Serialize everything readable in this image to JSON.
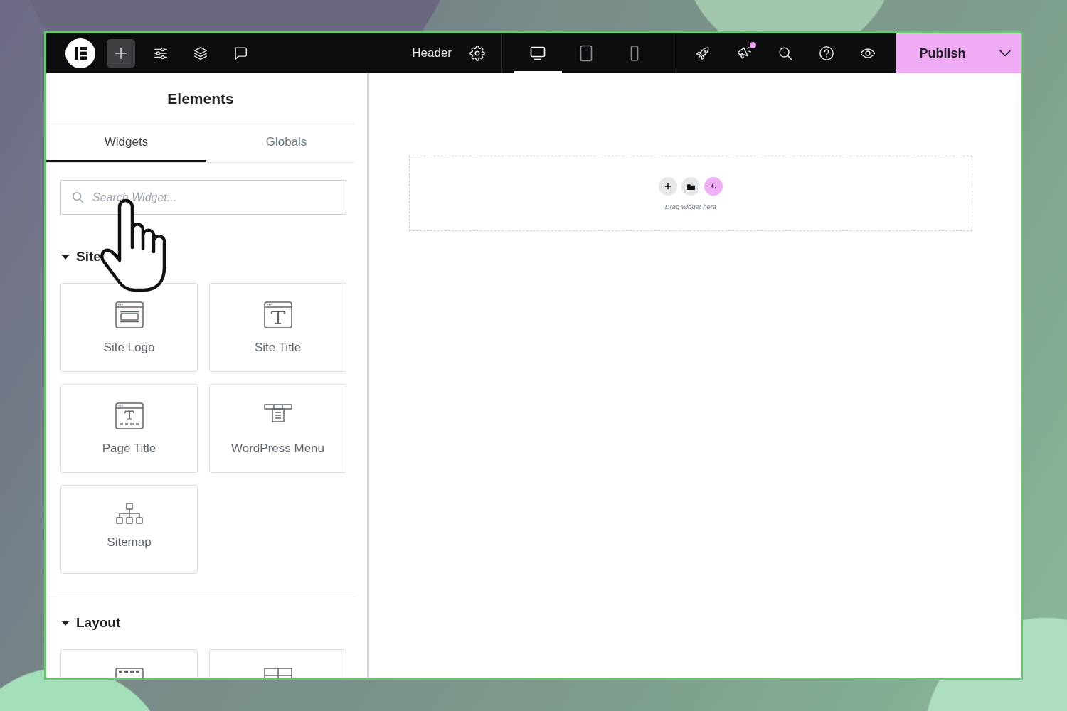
{
  "top_bar": {
    "left_tools": [
      {
        "selected": true
      },
      {
        "selected": false
      },
      {
        "selected": false
      },
      {
        "selected": false
      }
    ],
    "document": {
      "title": "Header"
    },
    "devices": [
      {
        "selected": true
      },
      {
        "selected": false
      },
      {
        "selected": false
      }
    ],
    "right_tools": [
      {
        "badge": false
      },
      {
        "badge": true
      },
      {
        "badge": false
      },
      {
        "badge": false
      },
      {
        "badge": false
      }
    ],
    "publish": {
      "label": "Publish"
    }
  },
  "panel": {
    "title": "Elements",
    "tabs": [
      {
        "label": "Widgets",
        "selected": true
      },
      {
        "label": "Globals",
        "selected": false
      }
    ],
    "search": {
      "placeholder": "Search Widget..."
    },
    "sections": [
      {
        "title": "Site",
        "expanded": true,
        "widgets": [
          {
            "kind": "logo",
            "label": "Site Logo"
          },
          {
            "kind": "title",
            "label": "Site Title"
          },
          {
            "kind": "pagetitle",
            "label": "Page Title"
          },
          {
            "kind": "menu",
            "label": "WordPress Menu"
          },
          {
            "kind": "sitemap",
            "label": "Sitemap"
          }
        ]
      },
      {
        "title": "Layout",
        "expanded": true,
        "widgets": [
          {
            "kind": "container"
          },
          {
            "kind": "grid"
          }
        ]
      }
    ]
  },
  "canvas": {
    "drop_zone": {
      "hint": "Drag widget here"
    }
  }
}
